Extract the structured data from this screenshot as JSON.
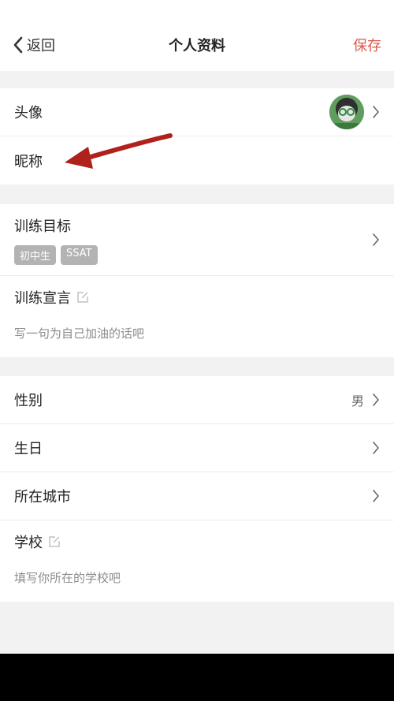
{
  "nav": {
    "back_label": "返回",
    "title": "个人资料",
    "save_label": "保存"
  },
  "profile": {
    "avatar_label": "头像",
    "nickname_label": "昵称"
  },
  "training": {
    "goal_label": "训练目标",
    "goal_tags": [
      "初中生",
      "SSAT"
    ],
    "declaration_label": "训练宣言",
    "declaration_placeholder": "写一句为自己加油的话吧"
  },
  "info": {
    "gender_label": "性别",
    "gender_value": "男",
    "birthday_label": "生日",
    "city_label": "所在城市",
    "school_label": "学校",
    "school_placeholder": "填写你所在的学校吧"
  },
  "colors": {
    "accent": "#e2574b",
    "annotation_arrow": "#b0211c",
    "tag_bg": "#b3b3b3"
  },
  "icons": {
    "back": "chevron-left-icon",
    "chevron": "chevron-right-icon",
    "edit": "edit-icon"
  }
}
